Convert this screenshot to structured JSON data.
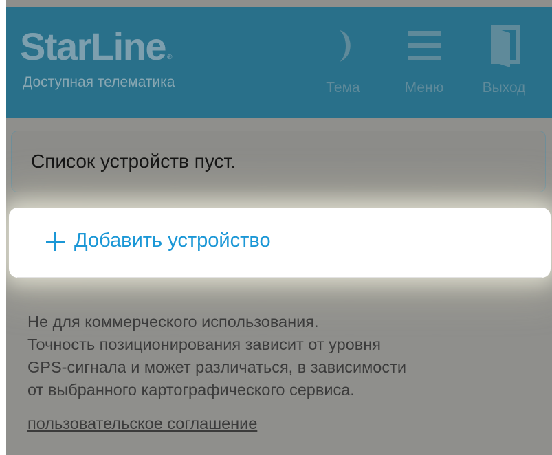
{
  "header": {
    "logo": "StarLine",
    "logo_reg": "®",
    "tagline": "Доступная телематика",
    "theme_label": "Тема",
    "menu_label": "Меню",
    "exit_label": "Выход",
    "icons": {
      "theme": "moon-icon",
      "menu": "hamburger-menu-icon",
      "exit": "door-exit-icon"
    }
  },
  "devices": {
    "empty_message": "Список устройств пуст."
  },
  "add_device": {
    "label": "Добавить устройство",
    "icon": "plus-icon"
  },
  "footer": {
    "disclaimer_lines": [
      "Не для коммерческого использования.",
      "Точность позиционирования зависит от уровня",
      "GPS-сигнала и может различаться, в зависимости",
      "от выбранного картографического сервиса."
    ],
    "terms_link": "пользовательское соглашение"
  },
  "colors": {
    "header_bg": "#29708a",
    "overlay_bg": "#8f8f8c",
    "accent": "#1b97d6",
    "card_bg": "#ffffff"
  }
}
